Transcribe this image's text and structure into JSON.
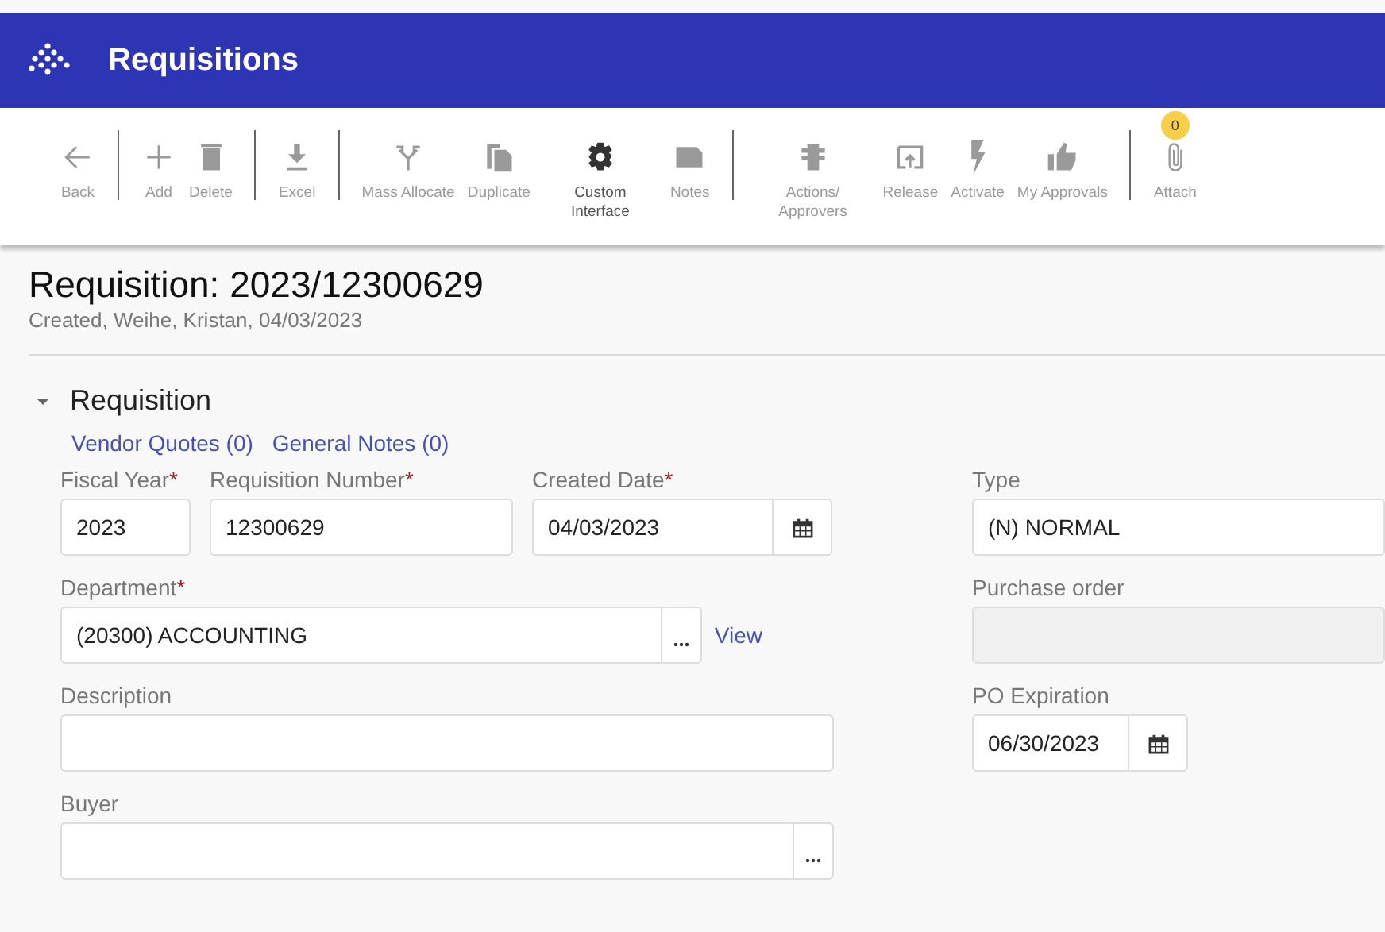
{
  "app_bar": {
    "title": "Requisitions"
  },
  "toolbar": {
    "groups": [
      [
        {
          "label": "Back",
          "disabled": true
        }
      ],
      [
        {
          "label": "Add",
          "disabled": true
        },
        {
          "label": "Delete",
          "disabled": true
        }
      ],
      [
        {
          "label": "Excel",
          "disabled": true
        }
      ],
      [
        {
          "label": "Mass Allocate",
          "disabled": true
        },
        {
          "label": "Duplicate",
          "disabled": true
        },
        {
          "label": "Custom Interface",
          "disabled": false
        },
        {
          "label": "Notes",
          "disabled": true
        }
      ],
      [
        {
          "label": "Actions/ Approvers",
          "disabled": true
        },
        {
          "label": "Release",
          "disabled": true
        },
        {
          "label": "Activate",
          "disabled": true
        },
        {
          "label": "My Approvals",
          "disabled": true
        }
      ],
      [
        {
          "label": "Attach",
          "disabled": true,
          "badge": "0"
        }
      ]
    ]
  },
  "page": {
    "title": "Requisition: 2023/12300629",
    "subtitle": "Created, Weihe, Kristan, 04/03/2023"
  },
  "section": {
    "title": "Requisition",
    "expanded": true,
    "links": [
      "Vendor Quotes (0)",
      "General Notes (0)"
    ],
    "left_rows": [
      [
        {
          "kind": "text",
          "label": "Fiscal Year",
          "required_mark": "*",
          "value": "2023",
          "disabled": false
        },
        {
          "kind": "text",
          "label": "Requisition Number",
          "required_mark": "*",
          "value": "12300629",
          "disabled": false
        },
        {
          "kind": "date",
          "label": "Created Date",
          "required_mark": "*",
          "value": "04/03/2023",
          "disabled": false
        }
      ],
      [
        {
          "kind": "lookup",
          "label": "Department",
          "required_mark": "*",
          "value": "(20300) ACCOUNTING",
          "disabled": false,
          "link": "View"
        }
      ],
      [
        {
          "kind": "text",
          "label": "Description",
          "disabled": false
        }
      ],
      [
        {
          "kind": "lookup",
          "label": "Buyer",
          "disabled": false
        }
      ]
    ],
    "right_fields": [
      {
        "kind": "text",
        "label": "Type",
        "value": "(N) NORMAL",
        "disabled": false
      },
      {
        "kind": "text",
        "label": "Purchase order",
        "disabled": true
      },
      {
        "kind": "date",
        "label": "PO Expiration",
        "value": "06/30/2023",
        "disabled": false
      }
    ]
  }
}
